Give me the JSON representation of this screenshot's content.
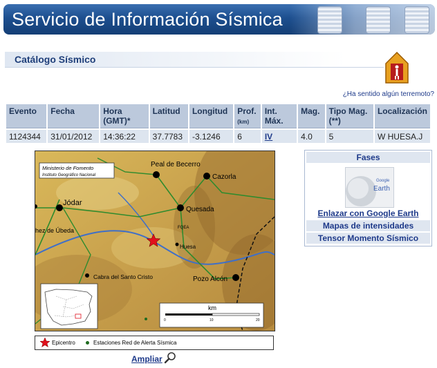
{
  "header": {
    "title": "Servicio de Información Sísmica"
  },
  "section": {
    "title": "Catálogo Sísmico"
  },
  "felt_link": "¿Ha sentido algún terremoto?",
  "table": {
    "headers": {
      "evento": "Evento",
      "fecha": "Fecha",
      "hora": "Hora",
      "hora_sub": "(GMT)*",
      "latitud": "Latitud",
      "longitud": "Longitud",
      "prof": "Prof.",
      "prof_sub": "(km)",
      "int": "Int.",
      "int_sub": "Máx.",
      "mag": "Mag.",
      "tipo": "Tipo Mag.",
      "tipo_sub": "(**)",
      "loc": "Localización"
    },
    "row": {
      "evento": "1124344",
      "fecha": "31/01/2012",
      "hora": "14:36:22",
      "latitud": "37.7783",
      "longitud": "-3.1246",
      "prof": "6",
      "int": "IV",
      "mag": "4.0",
      "tipo": "5",
      "loc": "W HUESA.J"
    }
  },
  "map": {
    "org_line1": "Ministerio de Fomento",
    "org_line2": "Instituto Geográfico Nacional",
    "places": {
      "peal": "Peal de Becerro",
      "cazorla": "Cazorla",
      "jodar": "Jódar",
      "quesada": "Quesada",
      "ubeda": "hez de Úbeda",
      "huesa": "Huesa",
      "cabra": "Cabra del Santo Cristo",
      "pozo": "Pozo Alcón",
      "fqea": "FQEA"
    },
    "scale": {
      "unit": "km",
      "t0": "0",
      "t10": "10",
      "t20": "20"
    }
  },
  "legend": {
    "epicentro": "Epicentro",
    "estaciones": "Estaciones Red de Alerta Sísmica"
  },
  "ampliar": "Ampliar",
  "fases": {
    "title": "Fases",
    "earth_logo_small": "Google",
    "earth_logo": "Earth",
    "google_earth": "Enlazar con Google Earth",
    "mapas": "Mapas de intensidades",
    "tensor": "Tensor Momento Sísmico"
  },
  "colors": {
    "banner": "#1d4f8f",
    "link": "#1e3a8a",
    "header_cell": "#bcc9dc",
    "data_cell": "#dde5ef",
    "epicenter": "#e0101c"
  }
}
